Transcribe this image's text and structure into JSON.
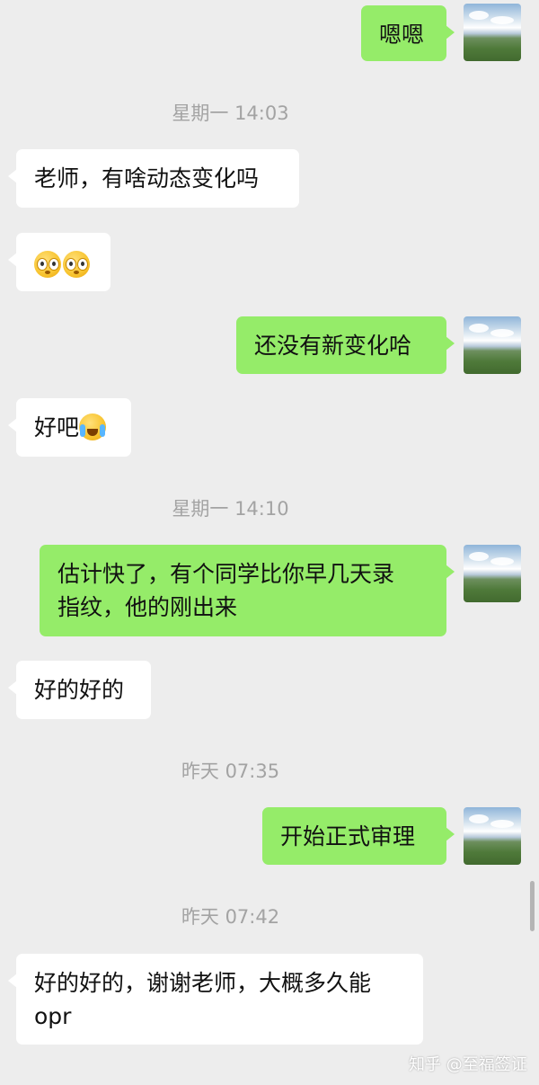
{
  "messages": [
    {
      "side": "right",
      "text": "嗯嗯"
    },
    {
      "timestamp": "星期一 14:03"
    },
    {
      "side": "left",
      "text": "老师，有啥动态变化吗"
    },
    {
      "side": "left",
      "emoji": [
        "flushed-face-icon",
        "flushed-face-icon"
      ]
    },
    {
      "side": "right",
      "text": "还没有新变化哈"
    },
    {
      "side": "left",
      "text": "好吧",
      "emoji": [
        "crying-laughing-face-icon"
      ]
    },
    {
      "timestamp": "星期一 14:10"
    },
    {
      "side": "right",
      "text": "估计快了，有个同学比你早几天录指纹，他的刚出来"
    },
    {
      "side": "left",
      "text": "好的好的"
    },
    {
      "timestamp": "昨天 07:35"
    },
    {
      "side": "right",
      "text": "开始正式审理"
    },
    {
      "timestamp": "昨天 07:42"
    },
    {
      "side": "left",
      "text": "好的好的，谢谢老师，大概多久能opr"
    }
  ],
  "chat": {
    "m0": "嗯嗯",
    "t1": "星期一 14:03",
    "m2": "老师，有啥动态变化吗",
    "m4": "还没有新变化哈",
    "m5": "好吧",
    "t6": "星期一 14:10",
    "m7a": "估计快了，有个同学比你早几天录",
    "m7b": "指纹，他的刚出来",
    "m8": "好的好的",
    "t9": "昨天 07:35",
    "m10": "开始正式审理",
    "t11": "昨天 07:42",
    "m12a": "好的好的，谢谢老师，大概多久能",
    "m12b": "opr"
  },
  "watermark": "知乎 @至福签证",
  "colors": {
    "background": "#ededed",
    "sent_bubble": "#95ec69",
    "received_bubble": "#ffffff",
    "timestamp": "#a3a3a3"
  }
}
